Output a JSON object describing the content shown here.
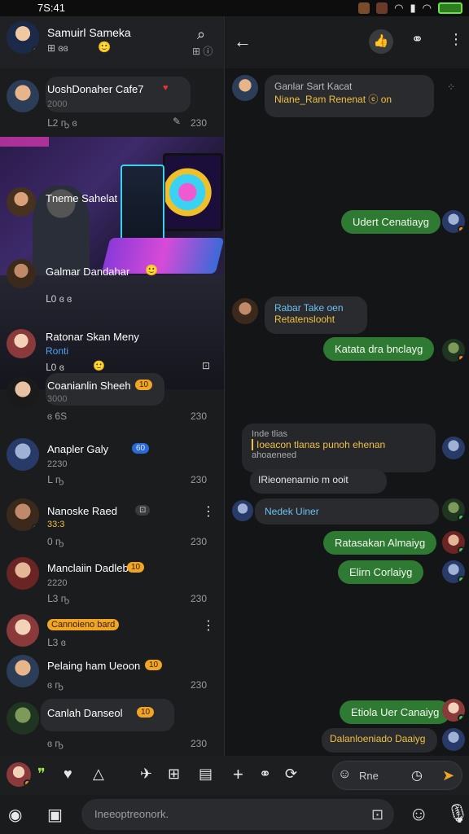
{
  "status": {
    "time": "7S:41"
  },
  "left_header": {
    "title": "Samuirl Sameka",
    "sub": "⊞ ɞɞ"
  },
  "chats": [
    {
      "name": "UoshDonaher Cafe7",
      "meta_left": "ᒪ2 ҧ ɞ",
      "meta_right": "230",
      "sub": "2000"
    },
    {
      "name": "Tneme Sahelat",
      "sub": ""
    },
    {
      "name": "Galmar Dandahar",
      "sub": "ᒪ0 ɞ ɞ",
      "badge": "🙂"
    },
    {
      "name": "Ratonar Skan Meny",
      "sub": "Ronti",
      "meta_left": "ᒪ0 ɞ"
    },
    {
      "name": "Coanianlin Sheeh",
      "sub": "3000",
      "meta_left": "ɞ 6S",
      "meta_right": "230"
    },
    {
      "name": "Anapler Galy",
      "sub": "2230",
      "meta_left": "ᒪ ҧ",
      "meta_right": "230"
    },
    {
      "name": "Nanoske Raed",
      "sub": "33:3",
      "meta_left": "0 ҧ",
      "meta_right": "230"
    },
    {
      "name": "Manclaiin Dadleb",
      "sub": "2220",
      "meta_left": "ᒪ3 ҧ",
      "meta_right": "230"
    },
    {
      "name": "Cannoieno bard",
      "sub": "ᒪ3 ɞ",
      "meta_left": ""
    },
    {
      "name": "Pelaing ham Ueoon",
      "sub": "",
      "meta_left": "ɞ ҧ",
      "meta_right": "230"
    },
    {
      "name": "Canlah Danseol",
      "sub": "",
      "meta_left": "ɞ ҧ",
      "meta_right": "230"
    }
  ],
  "right_header": {
    "thumb": "👍"
  },
  "messages": [
    {
      "side": "in",
      "text": "Ganlar Sart Kacat",
      "text2": "Niane_Ram Renenat ⓔ on"
    },
    {
      "side": "out",
      "text": "Udert Cenatiayg"
    },
    {
      "side": "in",
      "text": "Rabar Take oen",
      "text2": "Retatenslooht"
    },
    {
      "side": "out",
      "text": "Katata dra bnclayg"
    },
    {
      "side": "in",
      "text": "Inde tlias",
      "text2": "Ioeacon tlanas punoh ehenan",
      "text3": "ahoaeneed"
    },
    {
      "side": "in",
      "text": "IRieonenarnio m ooit"
    },
    {
      "side": "in",
      "text": "Nedek Uiner"
    },
    {
      "side": "out",
      "text": "Ratasakan Almaiyg"
    },
    {
      "side": "out",
      "text": "Elirn Corlaiyg"
    },
    {
      "side": "out",
      "text": "Etiola Uer Canaiyg"
    },
    {
      "side": "out",
      "text": "Dalanloeniado Daaiyg"
    }
  ],
  "composer_right": {
    "label": "Rne"
  },
  "composer": {
    "placeholder": "Ineeoptreonork."
  },
  "toolbar_icons": [
    "avatar",
    "quote-icon",
    "heart-icon",
    "triangle-icon",
    "bird-icon",
    "grid-icon",
    "calendar-icon",
    "plus-icon",
    "link-icon",
    "repeat-icon"
  ],
  "colors": {
    "accent_green": "#2f7a32",
    "accent_orange": "#f0a526",
    "background": "#161719"
  }
}
